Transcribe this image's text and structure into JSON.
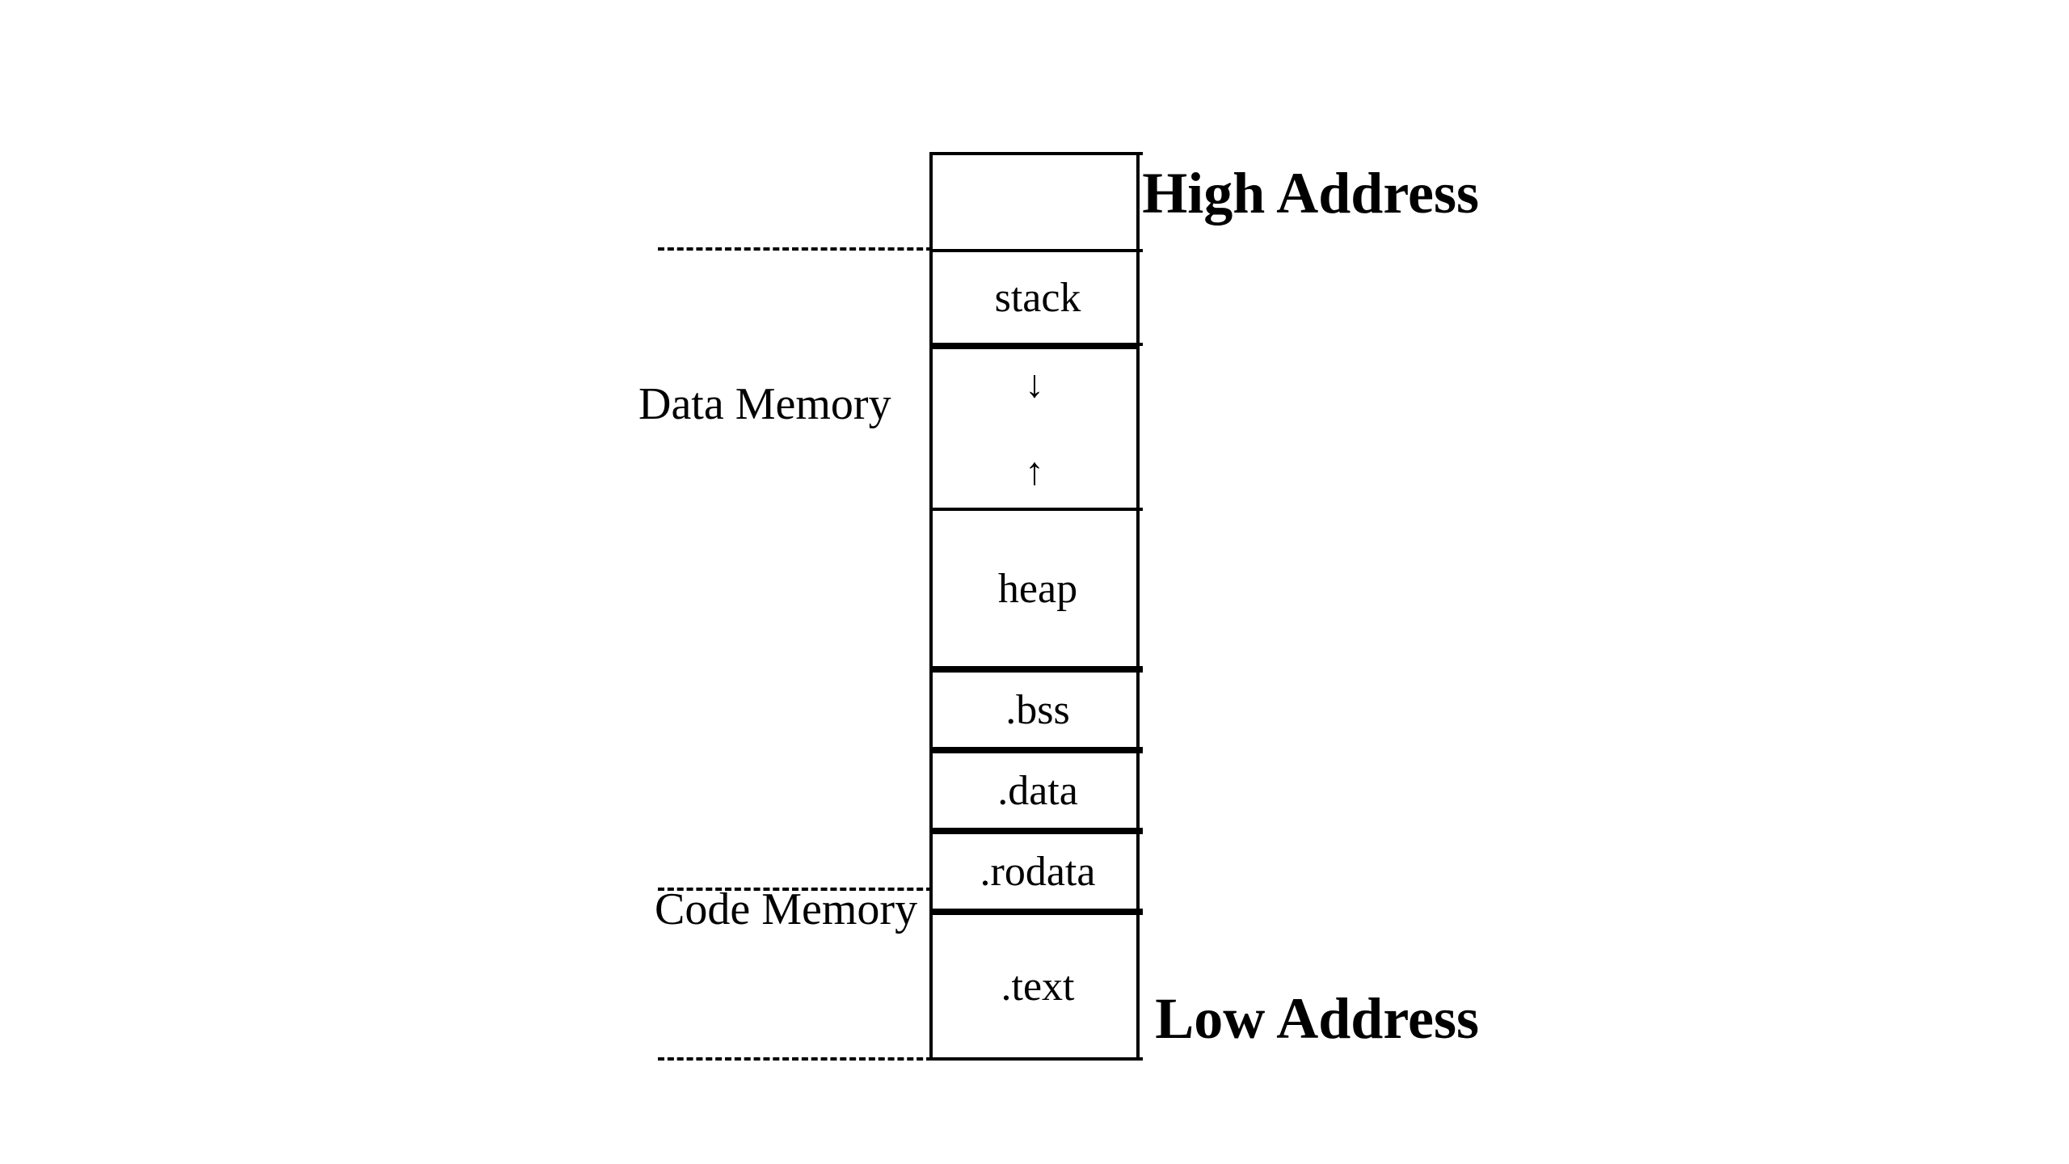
{
  "diagram": {
    "high_address_label": "High Address",
    "low_address_label": "Low Address",
    "data_memory_label": "Data Memory",
    "code_memory_label": "Code Memory",
    "segments": [
      {
        "name": "stack",
        "label": ".stack",
        "display": "stack"
      },
      {
        "name": "arrows",
        "label": "arrows"
      },
      {
        "name": "heap",
        "label": "heap",
        "display": "heap"
      },
      {
        "name": "bss",
        "label": ".bss",
        "display": ".bss"
      },
      {
        "name": "data",
        "label": ".data",
        "display": ".data"
      },
      {
        "name": "rodata",
        "label": ".rodata",
        "display": ".rodata"
      },
      {
        "name": "text",
        "label": ".text",
        "display": ".text"
      }
    ]
  }
}
